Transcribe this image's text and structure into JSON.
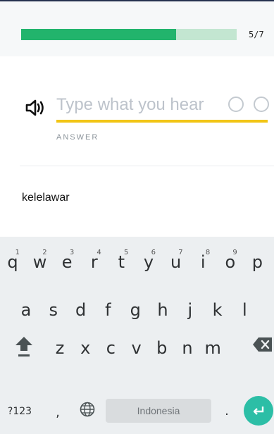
{
  "progress": {
    "completed": 5,
    "total": 7,
    "label": "5/7",
    "fill_fraction": 0.72
  },
  "exercise": {
    "input_placeholder": "Type what you hear",
    "input_value": "",
    "answer_label": "ANSWER",
    "speaker_icon": "speaker-icon",
    "status_icons": [
      "circle-icon",
      "circle-icon"
    ]
  },
  "result": {
    "word": "kelelawar"
  },
  "keyboard": {
    "row1": [
      {
        "key": "q",
        "hint": "1"
      },
      {
        "key": "w",
        "hint": "2"
      },
      {
        "key": "e",
        "hint": "3"
      },
      {
        "key": "r",
        "hint": "4"
      },
      {
        "key": "t",
        "hint": "5"
      },
      {
        "key": "y",
        "hint": "6"
      },
      {
        "key": "u",
        "hint": "7"
      },
      {
        "key": "i",
        "hint": "8"
      },
      {
        "key": "o",
        "hint": "9"
      },
      {
        "key": "p",
        "hint": ""
      }
    ],
    "row2": [
      "a",
      "s",
      "d",
      "f",
      "g",
      "h",
      "j",
      "k",
      "l"
    ],
    "row3": [
      "z",
      "x",
      "c",
      "v",
      "b",
      "n",
      "m"
    ],
    "symbols_label": "?123",
    "comma_label": ",",
    "space_label": "Indonesia",
    "period_label": ".",
    "icons": [
      "shift-icon",
      "backspace-icon",
      "globe-icon",
      "enter-icon"
    ],
    "colors": {
      "accent": "#2cbea6",
      "progress": "#22b46c",
      "underline": "#f2c516"
    }
  }
}
